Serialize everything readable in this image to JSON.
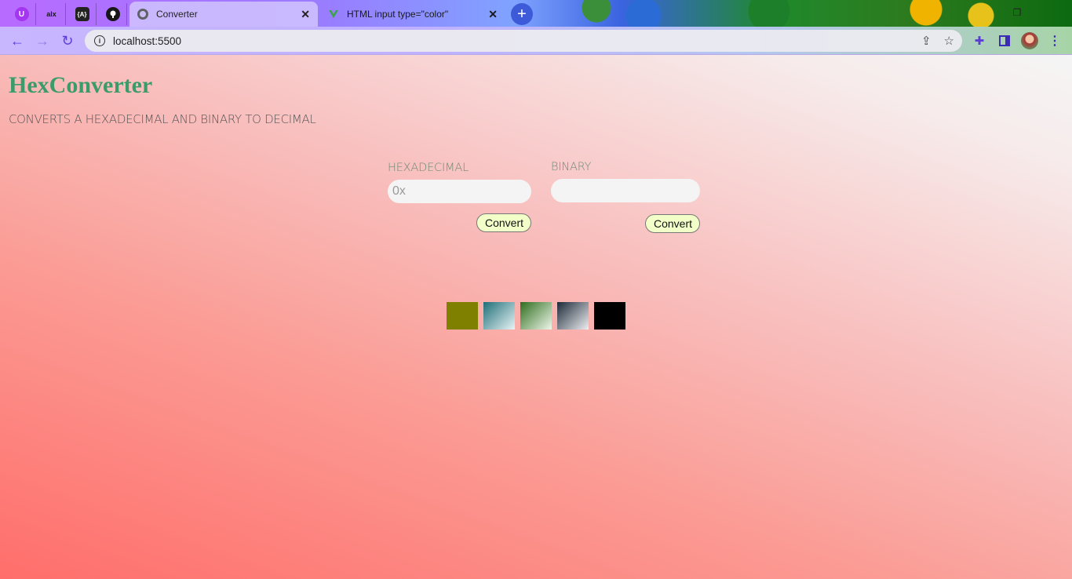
{
  "browser": {
    "pinned_tabs": [
      {
        "name": "udemy",
        "glyph": "U",
        "color": "#a435f0"
      },
      {
        "name": "alx",
        "glyph": "alx",
        "color": "#1a1a1a"
      },
      {
        "name": "code",
        "glyph": "{A}",
        "color": "#222222"
      },
      {
        "name": "github",
        "glyph": "●",
        "color": "#181717"
      }
    ],
    "tabs": [
      {
        "title": "Converter",
        "active": true
      },
      {
        "title": "HTML input type=\"color\"",
        "active": false
      }
    ],
    "url": "localhost:5500"
  },
  "app": {
    "title": "HexConverter",
    "subtitle": "CONVERTS A HEXADECIMAL AND BINARY TO DECIMAL",
    "hex": {
      "label": "HEXADECIMAL",
      "placeholder": "0x",
      "value": "",
      "button": "Convert"
    },
    "binary": {
      "label": "BINARY",
      "placeholder": "",
      "value": "",
      "button": "Convert"
    },
    "swatches": [
      {
        "name": "olive",
        "fill": "#808000"
      },
      {
        "name": "teal-gradient",
        "fill": "linear-gradient(135deg, #1f6f78, #e8f4f6)"
      },
      {
        "name": "green-gradient",
        "fill": "linear-gradient(135deg, #2f6e1e, #eef6ea)"
      },
      {
        "name": "slate-gradient",
        "fill": "linear-gradient(135deg, #1c2a38, #eeeef2)"
      },
      {
        "name": "black",
        "fill": "#000000"
      }
    ]
  }
}
